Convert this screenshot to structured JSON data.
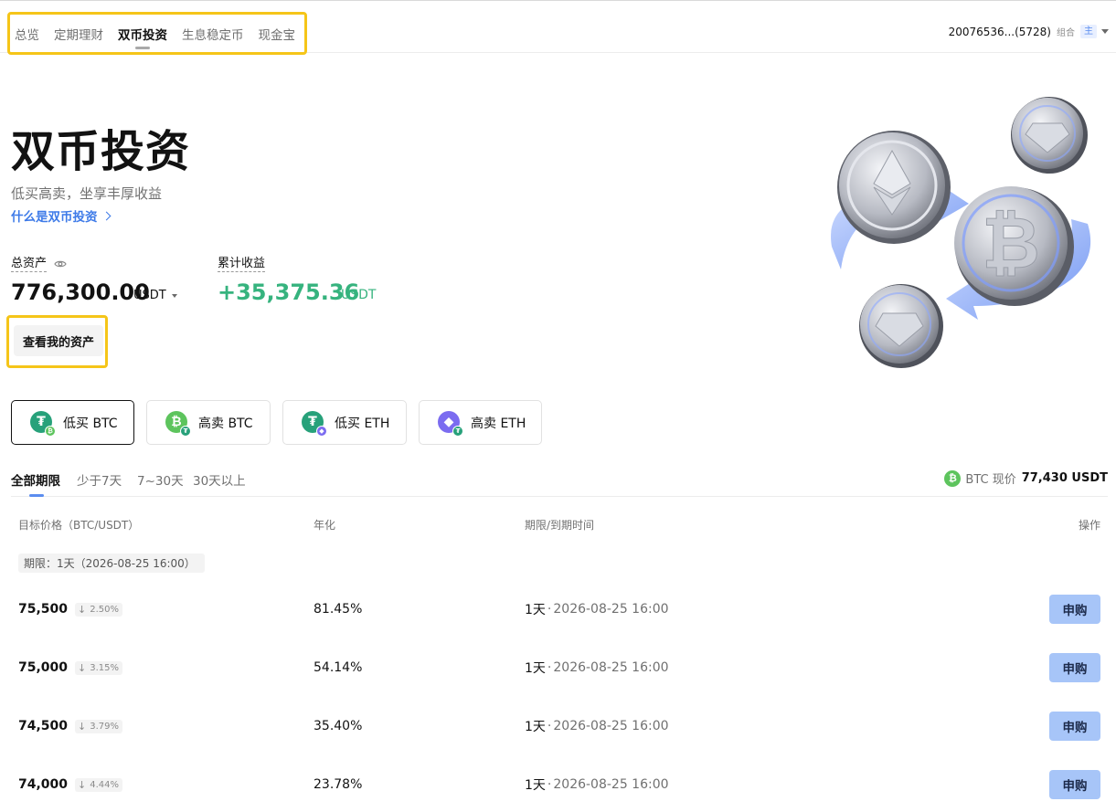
{
  "nav": {
    "tabs": [
      "总览",
      "定期理财",
      "双币投资",
      "生息稳定币",
      "现金宝"
    ],
    "active_index": 2,
    "account_id": "20076536...(5728)",
    "account_type": "组合",
    "account_badge": "主"
  },
  "hero": {
    "title": "双币投资",
    "subtitle": "低买高卖，坐享丰厚收益",
    "link": "什么是双币投资"
  },
  "assets": {
    "total_label": "总资产",
    "total_value": "776,300.00",
    "total_unit": "USDT",
    "profit_label": "累计收益",
    "profit_value": "+35,375.36",
    "profit_unit": "USDT",
    "my_assets_button": "查看我的资产"
  },
  "products": [
    {
      "label": "低买 BTC",
      "coin": "usdt-icon",
      "sub": "btc-icon",
      "active": true
    },
    {
      "label": "高卖 BTC",
      "coin": "btc-icon",
      "sub": "usdt-icon",
      "active": false
    },
    {
      "label": "低买 ETH",
      "coin": "usdt-icon",
      "sub": "eth-icon",
      "active": false
    },
    {
      "label": "高卖 ETH",
      "coin": "eth-icon",
      "sub": "usdt-icon",
      "active": false
    }
  ],
  "period_tabs": [
    "全部期限",
    "少于7天",
    "7~30天",
    "30天以上"
  ],
  "price_now": {
    "label": "BTC 现价",
    "value": "77,430 USDT"
  },
  "table": {
    "headers": {
      "price": "目标价格（BTC/USDT）",
      "apy": "年化",
      "term": "期限/到期时间",
      "action": "操作"
    },
    "group_label": "期限：1天（2026-08-25 16:00）",
    "rows": [
      {
        "price": "75,500",
        "change": "2.50%",
        "apy": "81.45%",
        "term": "1天",
        "expiry": "2026-08-25 16:00",
        "action": "申购"
      },
      {
        "price": "75,000",
        "change": "3.15%",
        "apy": "54.14%",
        "term": "1天",
        "expiry": "2026-08-25 16:00",
        "action": "申购"
      },
      {
        "price": "74,500",
        "change": "3.79%",
        "apy": "35.40%",
        "term": "1天",
        "expiry": "2026-08-25 16:00",
        "action": "申购"
      },
      {
        "price": "74,000",
        "change": "4.44%",
        "apy": "23.78%",
        "term": "1天",
        "expiry": "2026-08-25 16:00",
        "action": "申购"
      }
    ]
  },
  "colors": {
    "accent": "#3d7ae8",
    "profit": "#36b37e",
    "buy_button": "#a7c5f8",
    "highlight": "#f5c518"
  }
}
